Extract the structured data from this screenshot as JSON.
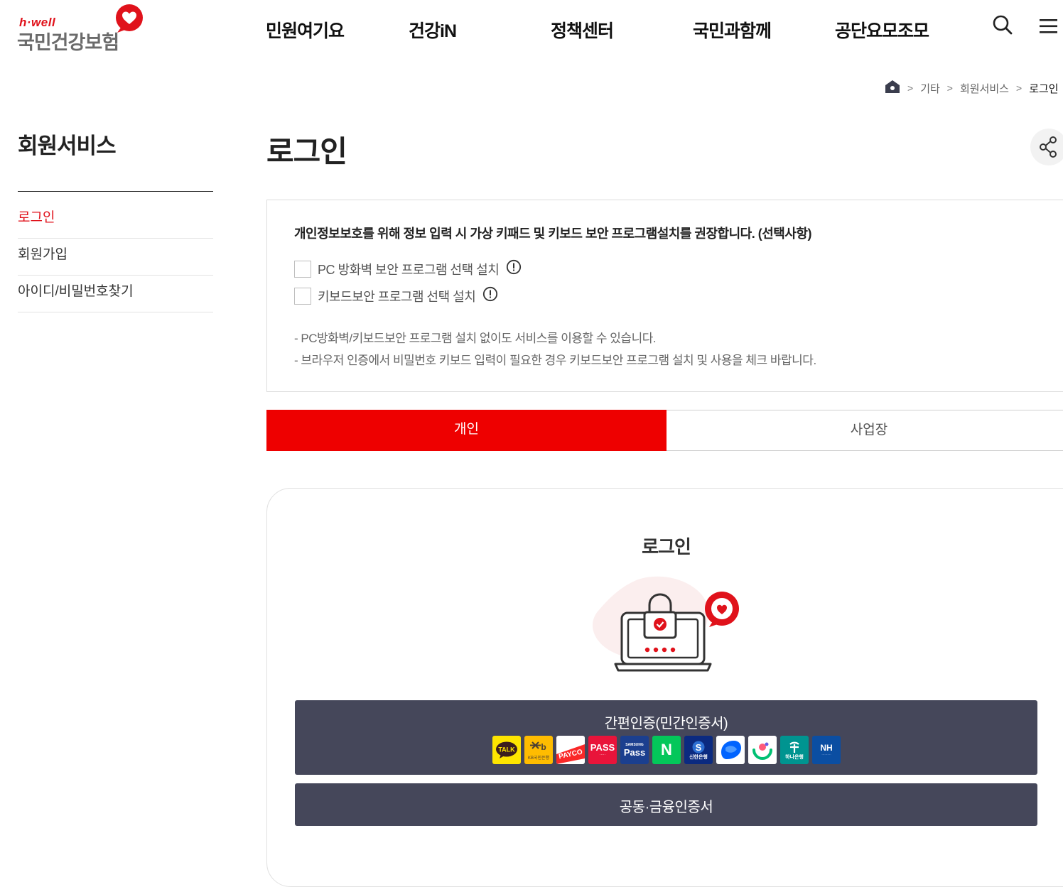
{
  "brand": {
    "logo_sub": "h·well",
    "logo_main": "국민건강보험"
  },
  "header": {
    "nav": [
      "민원여기요",
      "건강iN",
      "정책센터",
      "국민과함께",
      "공단요모조모"
    ],
    "icons": [
      "search-icon",
      "menu-icon"
    ]
  },
  "breadcrumb": {
    "items": [
      "기타",
      "회원서비스",
      "로그인"
    ]
  },
  "sidebar": {
    "title": "회원서비스",
    "items": [
      {
        "label": "로그인",
        "active": true
      },
      {
        "label": "회원가입",
        "active": false
      },
      {
        "label": "아이디/비밀번호찾기",
        "active": false
      }
    ]
  },
  "main": {
    "title": "로그인",
    "notice": {
      "title": "개인정보보호를 위해 정보 입력 시 가상 키패드 및 키보드 보안 프로그램설치를 권장합니다. (선택사항)",
      "options": [
        {
          "label": "PC 방화벽 보안 프로그램 선택 설치",
          "checked": false
        },
        {
          "label": "키보드보안 프로그램 선택 설치",
          "checked": false
        }
      ],
      "notes": [
        "- PC방화벽/키보드보안 프로그램 설치 없이도 서비스를 이용할 수 있습니다.",
        "- 브라우저 인증에서 비밀번호 키보드 입력이 필요한 경우 키보드보안 프로그램 설치 및 사용을 체크 바랍니다."
      ]
    },
    "tabs": [
      {
        "label": "개인",
        "active": true
      },
      {
        "label": "사업장",
        "active": false
      }
    ],
    "login_card": {
      "title": "로그인",
      "simple_auth_label": "간편인증(민간인증서)",
      "providers": [
        {
          "name": "카카오톡",
          "text": "TALK",
          "bg": "#fee500",
          "fg": "#3c1e1e"
        },
        {
          "name": "KB국민은행",
          "text": "KB국민은행",
          "bg": "#ffbc00",
          "fg": "#4b3f33"
        },
        {
          "name": "PAYCO",
          "text": "PAYCO",
          "bg": "#ffffff",
          "fg": "#fa2828"
        },
        {
          "name": "PASS",
          "text": "PASS",
          "bg": "#e9143a",
          "fg": "#ffffff"
        },
        {
          "name": "Samsung Pass",
          "text": "Pass",
          "bg": "#1b3f8f",
          "fg": "#ffffff"
        },
        {
          "name": "네이버",
          "text": "N",
          "bg": "#03c75a",
          "fg": "#ffffff"
        },
        {
          "name": "신한은행",
          "text": "신한은행",
          "bg": "#0b2a80",
          "fg": "#ffffff"
        },
        {
          "name": "토스",
          "text": "",
          "bg": "#ffffff",
          "fg": "#0064ff"
        },
        {
          "name": "뱅크샐러드",
          "text": "",
          "bg": "#ffffff",
          "fg": "#00c073"
        },
        {
          "name": "하나은행",
          "text": "하나은행",
          "bg": "#009490",
          "fg": "#ffffff"
        },
        {
          "name": "NH",
          "text": "NH",
          "bg": "#0b4ea2",
          "fg": "#ffffff"
        }
      ],
      "cert_label": "공동·금융인증서"
    }
  },
  "colors": {
    "accent": "#ee0000",
    "brand_red": "#e0121b",
    "dark_button": "#45475a"
  }
}
